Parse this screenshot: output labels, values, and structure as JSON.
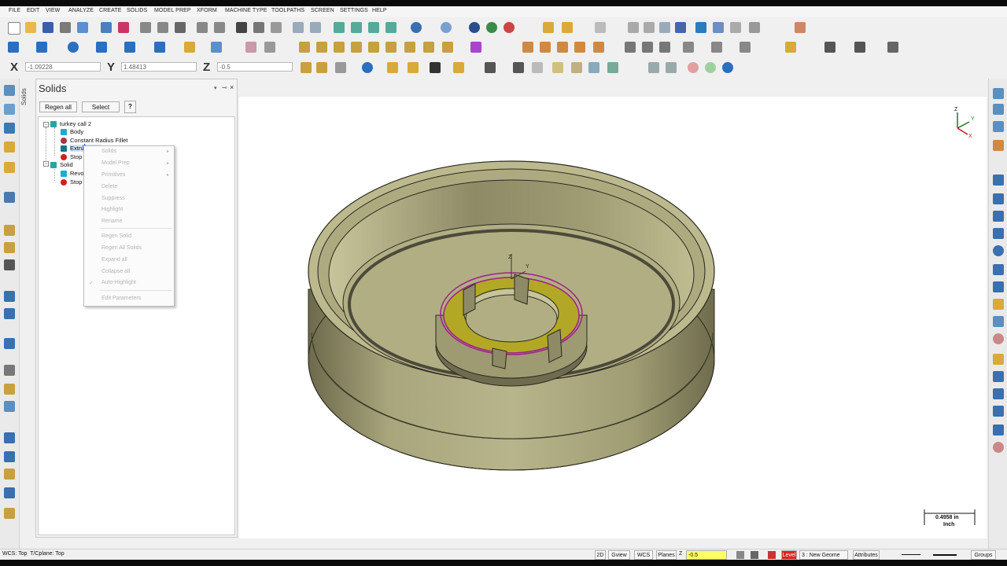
{
  "menu": [
    "FILE",
    "EDIT",
    "VIEW",
    "ANALYZE",
    "CREATE",
    "SOLIDS",
    "MODEL PREP",
    "XFORM",
    "MACHINE TYPE",
    "TOOLPATHS",
    "SCREEN",
    "SETTINGS",
    "HELP"
  ],
  "coords": {
    "x_label": "X",
    "x_value": "-1.09228",
    "y_label": "Y",
    "y_value": "1.48413",
    "z_label": "Z",
    "z_value": "-0.5"
  },
  "side_tab": "Solids",
  "panel": {
    "title": "Solids",
    "regen_all": "Regen all",
    "select": "Select",
    "help_icon": "?"
  },
  "tree": [
    {
      "label": "turkey call 2",
      "icon": "solid-icon",
      "color": "#2aa3a3"
    },
    {
      "label": "Body",
      "icon": "body-icon",
      "color": "#22aacc"
    },
    {
      "label": "Constant Radius Fillet",
      "icon": "fillet-icon",
      "color": "#aa3344"
    },
    {
      "label": "Extrude Cut",
      "icon": "extrude-icon",
      "color": "#117788"
    },
    {
      "label": "Stop Op",
      "icon": "stop-icon",
      "color": "#cc2222"
    },
    {
      "label": "Solid",
      "icon": "solid-icon",
      "color": "#2aa3a3"
    },
    {
      "label": "Revolve",
      "icon": "revolve-icon",
      "color": "#22aacc"
    },
    {
      "label": "Stop Op",
      "icon": "stop-icon",
      "color": "#cc2222"
    }
  ],
  "context_menu": [
    {
      "label": "Solids",
      "submenu": true
    },
    {
      "label": "Model Prep",
      "submenu": true
    },
    {
      "label": "Primitives",
      "submenu": true
    },
    {
      "label": "Delete",
      "submenu": false
    },
    {
      "label": "Suppress",
      "submenu": false
    },
    {
      "label": "Highlight",
      "submenu": false
    },
    {
      "label": "Rename",
      "submenu": false
    },
    {
      "label": "Regen Solid",
      "submenu": false
    },
    {
      "label": "Regen All Solids",
      "submenu": false
    },
    {
      "label": "Expand all",
      "submenu": false
    },
    {
      "label": "Collapse all",
      "submenu": false
    },
    {
      "label": "Auto-Highlight",
      "submenu": false,
      "checked": true
    },
    {
      "label": "Edit Parameters",
      "submenu": false
    }
  ],
  "viewport": {
    "scale_value": "0.4958 in",
    "scale_unit": "Inch",
    "axis_labels": {
      "x": "X",
      "y": "Y",
      "z": "Z"
    }
  },
  "status": {
    "left": "WCS: Top  T/Cplane: Top",
    "btn_2d": "2D",
    "gview": "Gview",
    "wcs": "WCS",
    "planes": "Planes",
    "z_label": "Z",
    "z_value": "-0.5",
    "level": "Level",
    "level_value": "3 : New Geome",
    "attributes": "Attributes",
    "groups": "Groups"
  },
  "colors": {
    "model_face": "#b5b185",
    "model_dark": "#6f6c4e",
    "highlight_yellow": "#b3a826",
    "selection_magenta": "#a0208a"
  }
}
